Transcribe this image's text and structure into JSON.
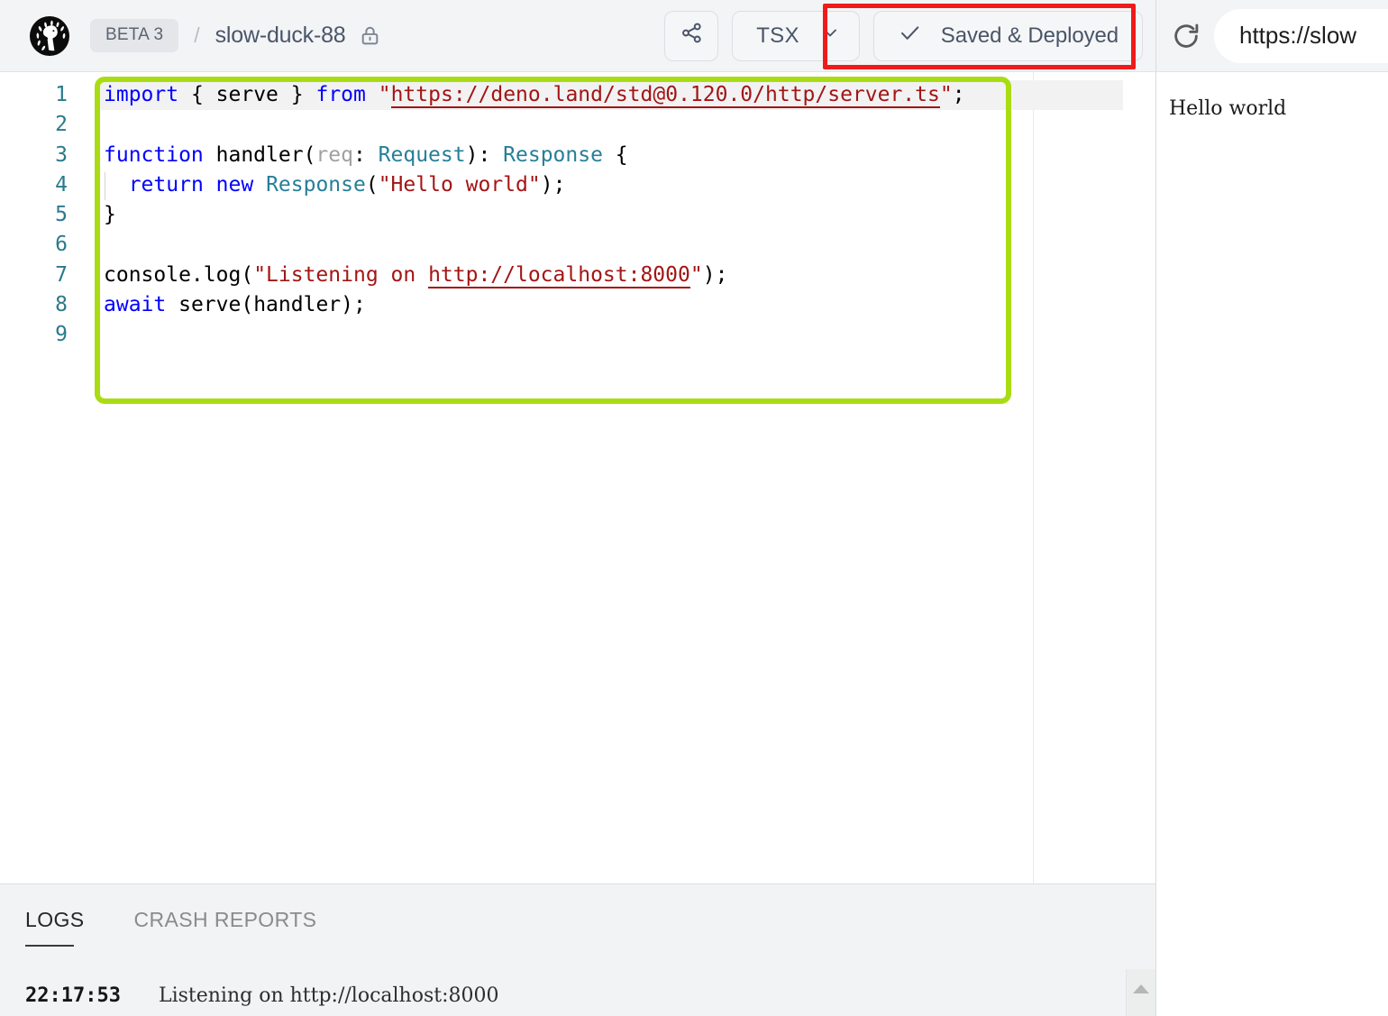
{
  "header": {
    "logo_alt": "deno-logo",
    "beta_badge": "BETA 3",
    "separator": "/",
    "project_name": "slow-duck-88",
    "lock_alt": "private-lock",
    "share_alt": "share",
    "language": "TSX",
    "deploy_status": "Saved & Deployed",
    "deploy_check": "✓"
  },
  "editor": {
    "line_numbers": [
      "1",
      "2",
      "3",
      "4",
      "5",
      "6",
      "7",
      "8",
      "9"
    ],
    "lines": [
      {
        "n": 1,
        "active": true,
        "tokens": [
          {
            "t": "import",
            "c": "kw"
          },
          {
            "t": " ",
            "c": "pln"
          },
          {
            "t": "{",
            "c": "pun"
          },
          {
            "t": " serve ",
            "c": "pln"
          },
          {
            "t": "}",
            "c": "pun"
          },
          {
            "t": " ",
            "c": "pln"
          },
          {
            "t": "from",
            "c": "kw"
          },
          {
            "t": " ",
            "c": "pln"
          },
          {
            "t": "\"",
            "c": "str"
          },
          {
            "t": "https://deno.land/std@0.120.0/http/server.ts",
            "c": "lnk"
          },
          {
            "t": "\"",
            "c": "str"
          },
          {
            "t": ";",
            "c": "pun"
          }
        ]
      },
      {
        "n": 2,
        "active": false,
        "tokens": []
      },
      {
        "n": 3,
        "active": false,
        "tokens": [
          {
            "t": "function",
            "c": "kw"
          },
          {
            "t": " handler",
            "c": "pln"
          },
          {
            "t": "(",
            "c": "pun"
          },
          {
            "t": "req",
            "c": "dim"
          },
          {
            "t": ": ",
            "c": "pun"
          },
          {
            "t": "Request",
            "c": "typ"
          },
          {
            "t": "): ",
            "c": "pun"
          },
          {
            "t": "Response",
            "c": "typ"
          },
          {
            "t": " {",
            "c": "pun"
          }
        ]
      },
      {
        "n": 4,
        "active": false,
        "indent_guide": true,
        "tokens": [
          {
            "t": "  ",
            "c": "pln"
          },
          {
            "t": "return",
            "c": "kw"
          },
          {
            "t": " ",
            "c": "pln"
          },
          {
            "t": "new",
            "c": "kw"
          },
          {
            "t": " ",
            "c": "pln"
          },
          {
            "t": "Response",
            "c": "typ"
          },
          {
            "t": "(",
            "c": "pun"
          },
          {
            "t": "\"Hello world\"",
            "c": "str"
          },
          {
            "t": ");",
            "c": "pun"
          }
        ]
      },
      {
        "n": 5,
        "active": false,
        "tokens": [
          {
            "t": "}",
            "c": "pun"
          }
        ]
      },
      {
        "n": 6,
        "active": false,
        "tokens": []
      },
      {
        "n": 7,
        "active": false,
        "tokens": [
          {
            "t": "console.log",
            "c": "pln"
          },
          {
            "t": "(",
            "c": "pun"
          },
          {
            "t": "\"",
            "c": "str"
          },
          {
            "t": "Listening on ",
            "c": "str"
          },
          {
            "t": "http://localhost:8000",
            "c": "lnk"
          },
          {
            "t": "\"",
            "c": "str"
          },
          {
            "t": ");",
            "c": "pun"
          }
        ]
      },
      {
        "n": 8,
        "active": false,
        "tokens": [
          {
            "t": "await",
            "c": "kw"
          },
          {
            "t": " serve",
            "c": "pln"
          },
          {
            "t": "(",
            "c": "pun"
          },
          {
            "t": "handler",
            "c": "pln"
          },
          {
            "t": ");",
            "c": "pun"
          }
        ]
      },
      {
        "n": 9,
        "active": false,
        "tokens": []
      }
    ]
  },
  "annotations": {
    "code_box_color": "#aadc14",
    "status_box_color": "#ef1b1b"
  },
  "logs": {
    "tabs": [
      {
        "label": "LOGS",
        "active": true
      },
      {
        "label": "CRASH REPORTS",
        "active": false
      }
    ],
    "entries": [
      {
        "time": "22:17:53",
        "message": "Listening on http://localhost:8000"
      }
    ]
  },
  "preview": {
    "reload_alt": "reload",
    "url": "https://slow",
    "body_text": "Hello world"
  }
}
